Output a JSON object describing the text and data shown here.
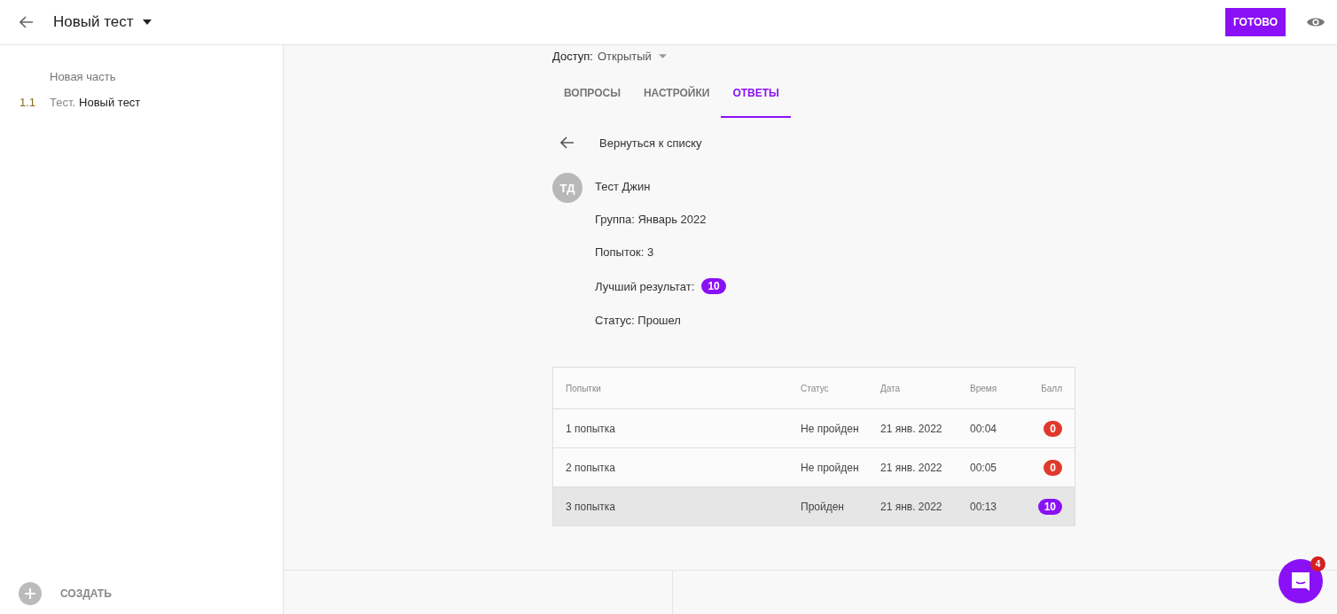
{
  "header": {
    "title": "Новый тест",
    "done_button": "ГОТОВО"
  },
  "sidebar": {
    "section": "Новая часть",
    "items": [
      {
        "number": "1.1",
        "prefix": "Тест.",
        "name": "Новый тест"
      }
    ],
    "create": "СОЗДАТЬ"
  },
  "access": {
    "label": "Доступ:",
    "value": "Открытый"
  },
  "tabs": [
    {
      "label": "ВОПРОСЫ",
      "selected": false
    },
    {
      "label": "НАСТРОЙКИ",
      "selected": false
    },
    {
      "label": "ОТВЕТЫ",
      "selected": true
    }
  ],
  "back_link": "Вернуться к списку",
  "student": {
    "initials": "ТД",
    "name": "Тест Джин",
    "group": "Группа: Январь 2022",
    "attempts": "Попыток: 3",
    "best_label": "Лучший результат:",
    "best_score": "10",
    "status": "Статус: Прошел"
  },
  "table": {
    "columns": [
      "Попытки",
      "Статус",
      "Дата",
      "Время",
      "Балл"
    ],
    "rows": [
      {
        "attempt": "1 попытка",
        "status": "Не пройден",
        "date": "21 янв. 2022",
        "time": "00:04",
        "score": "0",
        "color": "#e0392b",
        "selected": false
      },
      {
        "attempt": "2 попытка",
        "status": "Не пройден",
        "date": "21 янв. 2022",
        "time": "00:05",
        "score": "0",
        "color": "#e0392b",
        "selected": false
      },
      {
        "attempt": "3 попытка",
        "status": "Пройден",
        "date": "21 янв. 2022",
        "time": "00:13",
        "score": "10",
        "color": "#8a10f5",
        "selected": true
      }
    ]
  },
  "chat": {
    "badge": "4"
  }
}
